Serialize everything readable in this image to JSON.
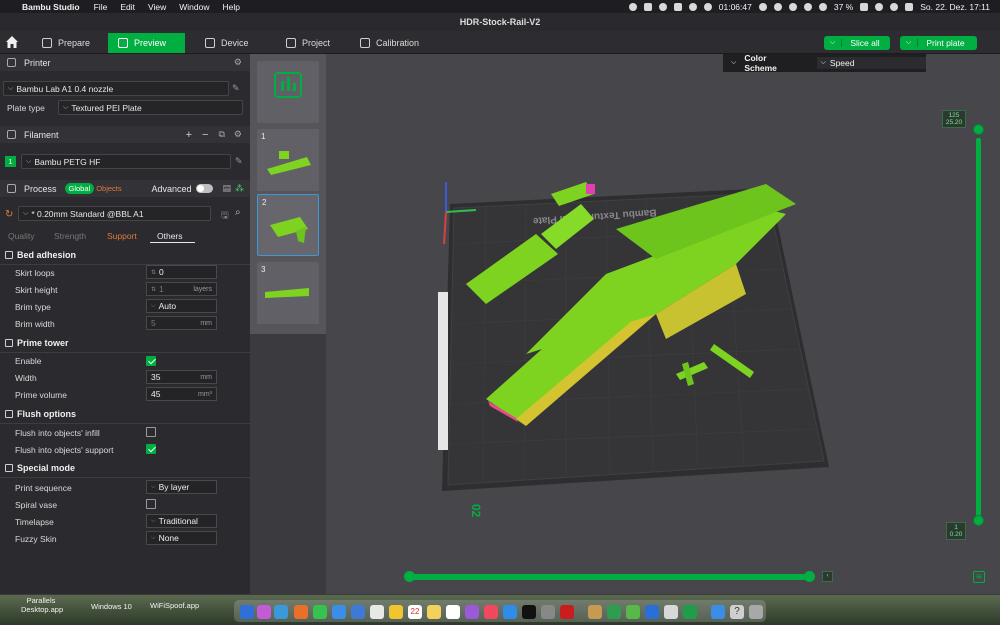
{
  "menubar": {
    "app_name": "Bambu Studio",
    "menus": [
      "File",
      "Edit",
      "View",
      "Window",
      "Help"
    ],
    "clock_left": "01:06:47",
    "battery": "37 %",
    "datetime": "So. 22. Dez.  17:11"
  },
  "window_title": "HDR-Stock-Rail-V2",
  "toolbar": {
    "tabs": [
      "Prepare",
      "Preview",
      "Device",
      "Project",
      "Calibration"
    ],
    "active_tab": "Preview",
    "slice_all": "Slice all",
    "print_plate": "Print plate"
  },
  "printer": {
    "section": "Printer",
    "name": "Bambu Lab A1 0.4 nozzle",
    "plate_type_label": "Plate type",
    "plate_type": "Textured PEI Plate"
  },
  "filament": {
    "section": "Filament",
    "slot": "1",
    "name": "Bambu PETG HF"
  },
  "process": {
    "section": "Process",
    "toggle_global": "Global",
    "toggle_objects": "Objects",
    "advanced": "Advanced",
    "preset": "* 0.20mm Standard @BBL A1",
    "subtabs": [
      "Quality",
      "Strength",
      "Support",
      "Others"
    ]
  },
  "settings": {
    "bed_adhesion": "Bed adhesion",
    "skirt_loops_label": "Skirt loops",
    "skirt_loops": "0",
    "skirt_height_label": "Skirt height",
    "skirt_height": "1",
    "skirt_height_unit": "layers",
    "brim_type_label": "Brim type",
    "brim_type": "Auto",
    "brim_width_label": "Brim width",
    "brim_width": "5",
    "brim_width_unit": "mm",
    "prime_tower": "Prime tower",
    "enable_label": "Enable",
    "width_label": "Width",
    "width": "35",
    "width_unit": "mm",
    "prime_volume_label": "Prime volume",
    "prime_volume": "45",
    "prime_volume_unit": "mm³",
    "flush_options": "Flush options",
    "flush_infill_label": "Flush into objects' infill",
    "flush_support_label": "Flush into objects' support",
    "special_mode": "Special mode",
    "print_sequence_label": "Print sequence",
    "print_sequence": "By layer",
    "spiral_vase_label": "Spiral vase",
    "timelapse_label": "Timelapse",
    "timelapse": "Traditional",
    "fuzzy_skin_label": "Fuzzy Skin",
    "fuzzy_skin": "None"
  },
  "plates": [
    "1",
    "2",
    "3"
  ],
  "color_scheme": {
    "label": "Color Scheme",
    "value": "Speed"
  },
  "bed_text": "Bambu Textured PEI Plate",
  "plate_number": "02",
  "layer_slider": {
    "top_value": "125",
    "top_height": "25.20",
    "bottom_value": "1",
    "bottom_height": "0.20"
  },
  "dock": {
    "left_items": [
      "Parallels Desktop.app",
      "Windows 10",
      "WiFiSpoof.app"
    ],
    "calendar_day": "22"
  },
  "colors": {
    "accent": "#00ae42",
    "model": "#7ed321",
    "model_shade": "#d8d02a"
  }
}
